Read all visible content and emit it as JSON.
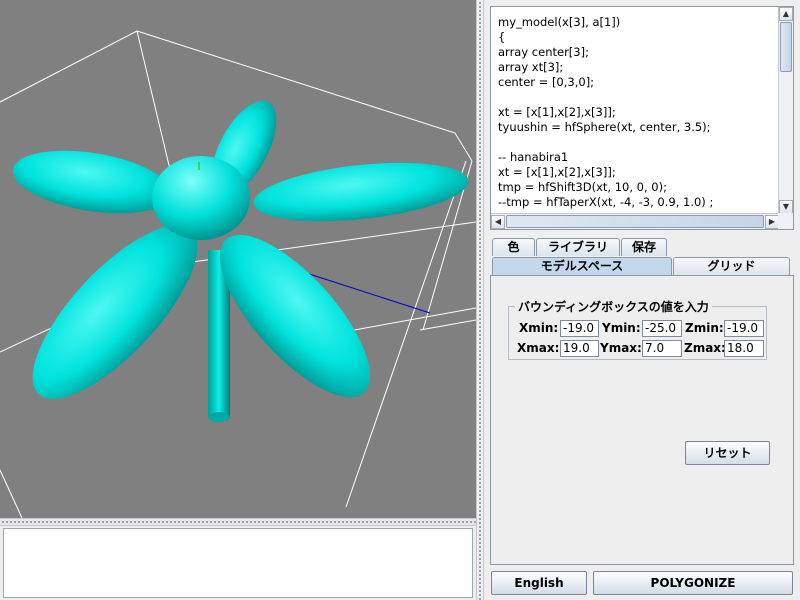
{
  "viewport": {
    "background": "#808080",
    "flower_color": "#00e6e0",
    "box_line_color": "#ffffff",
    "axis_color": "#0000cc"
  },
  "editor": {
    "lines": [
      "my_model(x[3], a[1])",
      "{",
      "array center[3];",
      "array xt[3];",
      "center = [0,3,0];",
      "",
      "xt = [x[1],x[2],x[3]];",
      "tyuushin = hfSphere(xt, center, 3.5);",
      "",
      "-- hanabira1",
      "xt = [x[1],x[2],x[3]];",
      "tmp = hfShift3D(xt, 10, 0, 0);",
      "--tmp = hfTaperX(xt, -4, -3, 0.9, 1.0) ;"
    ]
  },
  "tabs_top": [
    "色",
    "ライブラリ",
    "保存"
  ],
  "tabs_bottom": [
    "モデルスペース",
    "グリッド"
  ],
  "bbox": {
    "title": "バウンディングボックスの値を入力",
    "xmin_label": "Xmin:",
    "xmin": "-19.0",
    "ymin_label": "Ymin:",
    "ymin": "-25.0",
    "zmin_label": "Zmin:",
    "zmin": "-19.0",
    "xmax_label": "Xmax:",
    "xmax": "19.0",
    "ymax_label": "Ymax:",
    "ymax": "7.0",
    "zmax_label": "Zmax:",
    "zmax": "18.0"
  },
  "buttons": {
    "reset": "リセット",
    "english": "English",
    "polygonize": "POLYGONIZE"
  }
}
